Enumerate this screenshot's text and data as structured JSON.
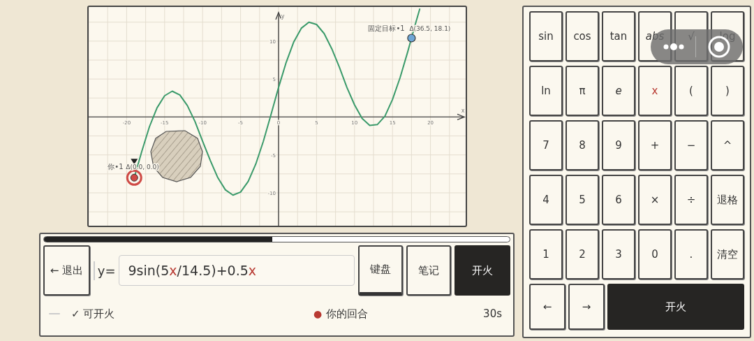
{
  "graph": {
    "chart_data": {
      "type": "line",
      "xlabel": "x",
      "ylabel": "y",
      "xlim": [
        -25,
        25
      ],
      "ylim": [
        -14.7,
        14.5
      ],
      "xticks": [
        -20,
        -15,
        -10,
        -5,
        0,
        5,
        10,
        15,
        20
      ],
      "yticks": [
        -10,
        -5,
        5,
        10
      ],
      "x": [
        -19,
        -18,
        -17,
        -16,
        -15,
        -14,
        -13,
        -12,
        -11,
        -10,
        -9,
        -8,
        -7,
        -6,
        -5,
        -4,
        -3,
        -2,
        -1,
        0,
        1,
        2,
        3,
        4,
        5,
        6,
        7,
        8,
        9,
        10,
        11,
        12,
        13,
        14,
        15,
        16,
        17,
        18,
        18.6
      ],
      "series": [
        {
          "color": "#3a9a6a",
          "values": [
            -8,
            -4.5,
            -1.3,
            1.2,
            2.8,
            3.4,
            2.9,
            1.5,
            -0.6,
            -3.2,
            -5.7,
            -8,
            -9.6,
            -10.3,
            -9.9,
            -8.5,
            -6.2,
            -3.2,
            0.3,
            3.9,
            7.2,
            9.9,
            11.7,
            12.5,
            12.2,
            11,
            9,
            6.6,
            3.9,
            1.6,
            -0.2,
            -1.1,
            -1,
            0.1,
            2.3,
            5.2,
            8.6,
            12.2,
            14.3
          ]
        }
      ],
      "grid": true
    },
    "markers": [
      {
        "kind": "player",
        "label": "你•1",
        "detail": "Δ(0.0, 0.0)"
      },
      {
        "kind": "target",
        "label": "固定目标•1",
        "detail": "Δ(36.5, 18.1)"
      }
    ]
  },
  "shot_progress": {
    "level": 0.49
  },
  "exit_button": {
    "label": "← 退出"
  },
  "expression": {
    "prefix": "y=",
    "parts": [
      {
        "text": "9sin(5",
        "kind": "num"
      },
      {
        "text": "x",
        "kind": "var"
      },
      {
        "text": "/14.5)+0.5",
        "kind": "num"
      },
      {
        "text": "x",
        "kind": "var"
      }
    ]
  },
  "tools": [
    {
      "label": "键盘",
      "selected": true
    },
    {
      "label": "笔记",
      "selected": false
    }
  ],
  "fire_button": {
    "label": "开火"
  },
  "status": {
    "ready": "✓ 可开火",
    "turn_dot": "●",
    "turn": "你的回合",
    "timer": "30s"
  },
  "keyboard": {
    "rows": [
      [
        {
          "label": "sin",
          "kind": "plain"
        },
        {
          "label": "cos",
          "kind": "plain"
        },
        {
          "label": "tan",
          "kind": "plain"
        },
        {
          "label": "abs",
          "kind": "italic"
        },
        {
          "label": "√",
          "kind": "plain"
        },
        {
          "label": "log",
          "kind": "plain"
        }
      ],
      [
        {
          "label": "ln",
          "kind": "plain"
        },
        {
          "label": "π",
          "kind": "plain"
        },
        {
          "label": "e",
          "kind": "italic"
        },
        {
          "label": "x",
          "kind": "var"
        },
        {
          "label": "(",
          "kind": "plain"
        },
        {
          "label": ")",
          "kind": "plain"
        }
      ],
      [
        {
          "label": "7",
          "kind": "plain"
        },
        {
          "label": "8",
          "kind": "plain"
        },
        {
          "label": "9",
          "kind": "plain"
        },
        {
          "label": "+",
          "kind": "plain"
        },
        {
          "label": "−",
          "kind": "plain"
        },
        {
          "label": "^",
          "kind": "plain"
        }
      ],
      [
        {
          "label": "4",
          "kind": "plain"
        },
        {
          "label": "5",
          "kind": "plain"
        },
        {
          "label": "6",
          "kind": "plain"
        },
        {
          "label": "×",
          "kind": "plain"
        },
        {
          "label": "÷",
          "kind": "plain"
        },
        {
          "label": "退格",
          "kind": "plain"
        }
      ],
      [
        {
          "label": "1",
          "kind": "plain"
        },
        {
          "label": "2",
          "kind": "plain"
        },
        {
          "label": "3",
          "kind": "plain"
        },
        {
          "label": "0",
          "kind": "plain"
        },
        {
          "label": ".",
          "kind": "plain"
        },
        {
          "label": "清空",
          "kind": "plain"
        }
      ]
    ],
    "bottom": [
      {
        "label": "←",
        "kind": "plain"
      },
      {
        "label": "→",
        "kind": "plain"
      },
      {
        "label": "开火",
        "kind": "fire"
      }
    ]
  }
}
